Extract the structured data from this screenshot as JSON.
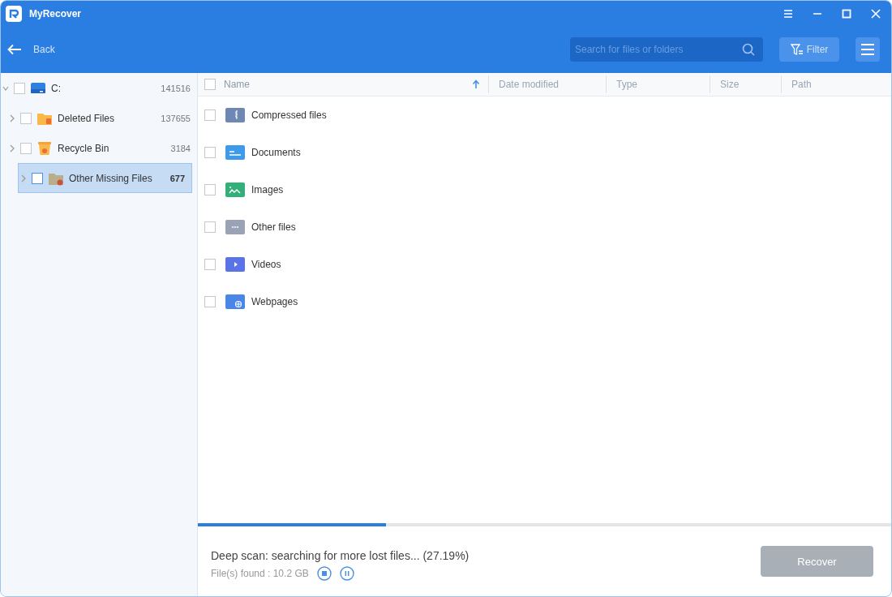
{
  "window": {
    "title": "MyRecover"
  },
  "toolbar": {
    "back": "Back",
    "search": {
      "placeholder": "Search for files or folders"
    },
    "filter": "Filter"
  },
  "tree": [
    {
      "label": "C:",
      "count": "141516",
      "kind": "drive",
      "expanded": true,
      "checked": false,
      "selected": false,
      "children": [
        {
          "label": "Deleted Files",
          "count": "137655",
          "kind": "deleted",
          "expanded": false,
          "checked": false,
          "selected": false
        },
        {
          "label": "Recycle Bin",
          "count": "3184",
          "kind": "recycle",
          "expanded": false,
          "checked": false,
          "selected": false
        },
        {
          "label": "Other Missing Files",
          "count": "677",
          "kind": "missing",
          "expanded": false,
          "checked": false,
          "selected": true
        }
      ]
    }
  ],
  "table": {
    "all_checked": false,
    "columns": [
      {
        "label": "Name",
        "sorted": true
      },
      {
        "label": "Date modified",
        "sorted": false
      },
      {
        "label": "Type",
        "sorted": false
      },
      {
        "label": "Size",
        "sorted": false
      },
      {
        "label": "Path",
        "sorted": false
      }
    ],
    "rows": [
      {
        "name": "Compressed files",
        "kind": "compressed",
        "color": "#6f87b3",
        "checked": false
      },
      {
        "name": "Documents",
        "kind": "documents",
        "color": "#3d9be9",
        "checked": false
      },
      {
        "name": "Images",
        "kind": "images",
        "color": "#33b07a",
        "checked": false
      },
      {
        "name": "Other files",
        "kind": "other",
        "color": "#9aa3b5",
        "checked": false
      },
      {
        "name": "Videos",
        "kind": "videos",
        "color": "#5a73e6",
        "checked": false
      },
      {
        "name": "Webpages",
        "kind": "webpages",
        "color": "#4a86e8",
        "checked": false
      }
    ]
  },
  "status": {
    "level": 0.2719,
    "message": "Deep scan: searching for more lost files... (27.19%)",
    "found": "File(s) found : 10.2 GB",
    "recover": {
      "label": "Recover",
      "disabled": true
    }
  }
}
